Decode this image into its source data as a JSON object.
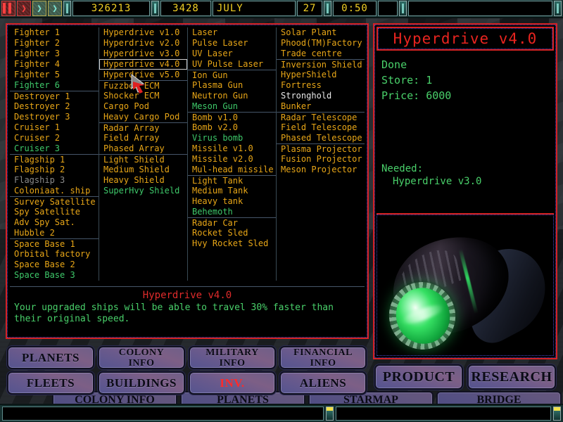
{
  "topbar": {
    "controls": [
      {
        "name": "pause-button",
        "glyph": "▐▌"
      },
      {
        "name": "play-button",
        "glyph": "❯"
      },
      {
        "name": "fast-forward-button",
        "glyph": "❯"
      },
      {
        "name": "fast-forward-2-button",
        "glyph": "❯"
      }
    ],
    "money": "326213",
    "score": "3428",
    "month": "JULY",
    "day": "27",
    "time": "0:50",
    "message": ""
  },
  "tech_columns": [
    {
      "name": "ships",
      "items": [
        {
          "label": "Fighter 1",
          "state": "available"
        },
        {
          "label": "Fighter 2",
          "state": "available"
        },
        {
          "label": "Fighter 3",
          "state": "available"
        },
        {
          "label": "Fighter 4",
          "state": "available"
        },
        {
          "label": "Fighter 5",
          "state": "available"
        },
        {
          "label": "Fighter 6",
          "state": "researching"
        },
        {
          "label": "Destroyer 1",
          "state": "available",
          "group_start": true
        },
        {
          "label": "Destroyer 2",
          "state": "available"
        },
        {
          "label": "Destroyer 3",
          "state": "available"
        },
        {
          "label": "Cruiser 1",
          "state": "available"
        },
        {
          "label": "Cruiser 2",
          "state": "available"
        },
        {
          "label": "Cruiser 3",
          "state": "researching"
        },
        {
          "label": "Flagship 1",
          "state": "available",
          "group_start": true
        },
        {
          "label": "Flagship 2",
          "state": "available"
        },
        {
          "label": "Flagship 3",
          "state": "locked"
        },
        {
          "label": "Coloniaat. ship",
          "state": "available"
        },
        {
          "label": "Survey Satellite",
          "state": "available",
          "group_start": true
        },
        {
          "label": "Spy Satellite",
          "state": "available"
        },
        {
          "label": "Adv Spy Sat.",
          "state": "available"
        },
        {
          "label": "Hubble 2",
          "state": "available"
        },
        {
          "label": "Space Base 1",
          "state": "available",
          "group_start": true
        },
        {
          "label": "Orbital factory",
          "state": "available"
        },
        {
          "label": "Space Base 2",
          "state": "available"
        },
        {
          "label": "Space Base 3",
          "state": "researching"
        }
      ]
    },
    {
      "name": "drives-and-equipment",
      "items": [
        {
          "label": "Hyperdrive v1.0",
          "state": "available"
        },
        {
          "label": "Hyperdrive v2.0",
          "state": "available"
        },
        {
          "label": "Hyperdrive v3.0",
          "state": "available"
        },
        {
          "label": "Hyperdrive v4.0",
          "state": "available",
          "selected": true
        },
        {
          "label": "Hyperdrive v5.0",
          "state": "available"
        },
        {
          "label": "Fuzzbox ECM",
          "state": "available",
          "group_start": true
        },
        {
          "label": "Shocker ECM",
          "state": "available"
        },
        {
          "label": "Cargo Pod",
          "state": "available"
        },
        {
          "label": "Heavy Cargo Pod",
          "state": "available"
        },
        {
          "label": "Radar Array",
          "state": "available",
          "group_start": true
        },
        {
          "label": "Field Array",
          "state": "available"
        },
        {
          "label": "Phased Array",
          "state": "available"
        },
        {
          "label": "Light Shield",
          "state": "available",
          "group_start": true
        },
        {
          "label": "Medium Shield",
          "state": "available"
        },
        {
          "label": "Heavy Shield",
          "state": "available"
        },
        {
          "label": "SuperHvy Shield",
          "state": "researching"
        }
      ]
    },
    {
      "name": "weapons-and-vehicles",
      "items": [
        {
          "label": "Laser",
          "state": "available"
        },
        {
          "label": "Pulse Laser",
          "state": "available"
        },
        {
          "label": "UV Laser",
          "state": "available"
        },
        {
          "label": "UV Pulse Laser",
          "state": "available"
        },
        {
          "label": "Ion Gun",
          "state": "available",
          "group_start": true
        },
        {
          "label": "Plasma Gun",
          "state": "available"
        },
        {
          "label": "Neutron Gun",
          "state": "available"
        },
        {
          "label": "Meson Gun",
          "state": "researching"
        },
        {
          "label": "Bomb v1.0",
          "state": "available",
          "group_start": true
        },
        {
          "label": "Bomb v2.0",
          "state": "available"
        },
        {
          "label": "Virus bomb",
          "state": "researching"
        },
        {
          "label": "Missile v1.0",
          "state": "available"
        },
        {
          "label": "Missile v2.0",
          "state": "available"
        },
        {
          "label": "Mul-head missile",
          "state": "available"
        },
        {
          "label": "Light Tank",
          "state": "available",
          "group_start": true
        },
        {
          "label": "Medium Tank",
          "state": "available"
        },
        {
          "label": "Heavy tank",
          "state": "available"
        },
        {
          "label": "Behemoth",
          "state": "researching"
        },
        {
          "label": "Radar Car",
          "state": "available",
          "group_start": true
        },
        {
          "label": "Rocket Sled",
          "state": "available"
        },
        {
          "label": "Hvy Rocket Sled",
          "state": "available"
        }
      ]
    },
    {
      "name": "buildings",
      "items": [
        {
          "label": "Solar Plant",
          "state": "available"
        },
        {
          "label": "Phood(TM)Factory",
          "state": "available"
        },
        {
          "label": "Trade centre",
          "state": "available"
        },
        {
          "label": "Inversion Shield",
          "state": "available",
          "group_start": true
        },
        {
          "label": "HyperShield",
          "state": "available"
        },
        {
          "label": "Fortress",
          "state": "available"
        },
        {
          "label": "Stronghold",
          "state": "highlighted"
        },
        {
          "label": "Bunker",
          "state": "available"
        },
        {
          "label": "Radar Telescope",
          "state": "available",
          "group_start": true
        },
        {
          "label": "Field Telescope",
          "state": "available"
        },
        {
          "label": "Phased Telescope",
          "state": "available"
        },
        {
          "label": "Plasma Projector",
          "state": "available",
          "group_start": true
        },
        {
          "label": "Fusion Projector",
          "state": "available"
        },
        {
          "label": "Meson Projector",
          "state": "available"
        }
      ]
    }
  ],
  "description": {
    "title": "Hyperdrive v4.0",
    "text": "Your upgraded ships will be able to travel 30% faster than their original speed."
  },
  "detail": {
    "title": "Hyperdrive v4.0",
    "status": "Done",
    "store_label": "Store: 1",
    "price_label": "Price: 6000",
    "needed_header": "Needed:",
    "needed_items": [
      "Hyperdrive v3.0"
    ],
    "render_alt": "hyperdrive-engine-render"
  },
  "buttons": {
    "grid": [
      {
        "label": "PLANETS",
        "active": false
      },
      {
        "label": "COLONY\nINFO",
        "active": false
      },
      {
        "label": "MILITARY\nINFO",
        "active": false
      },
      {
        "label": "FINANCIAL\nINFO",
        "active": false
      },
      {
        "label": "FLEETS",
        "active": false
      },
      {
        "label": "BUILDINGS",
        "active": false
      },
      {
        "label": "INV.",
        "active": true
      },
      {
        "label": "ALIENS",
        "active": false
      }
    ],
    "right": [
      {
        "label": "PRODUCT"
      },
      {
        "label": "RESEARCH"
      }
    ],
    "background_row": [
      "COLONY INFO",
      "PLANETS",
      "STARMAP",
      "BRIDGE"
    ]
  },
  "colors": {
    "panel_border": "#d42222",
    "accent_red": "#e8241f",
    "text_amber": "#e8a617",
    "text_green": "#3ec96a",
    "text_gray": "#8a8a8a",
    "readout_yellow": "#f2d024",
    "button_purple": "#6f5f88"
  }
}
